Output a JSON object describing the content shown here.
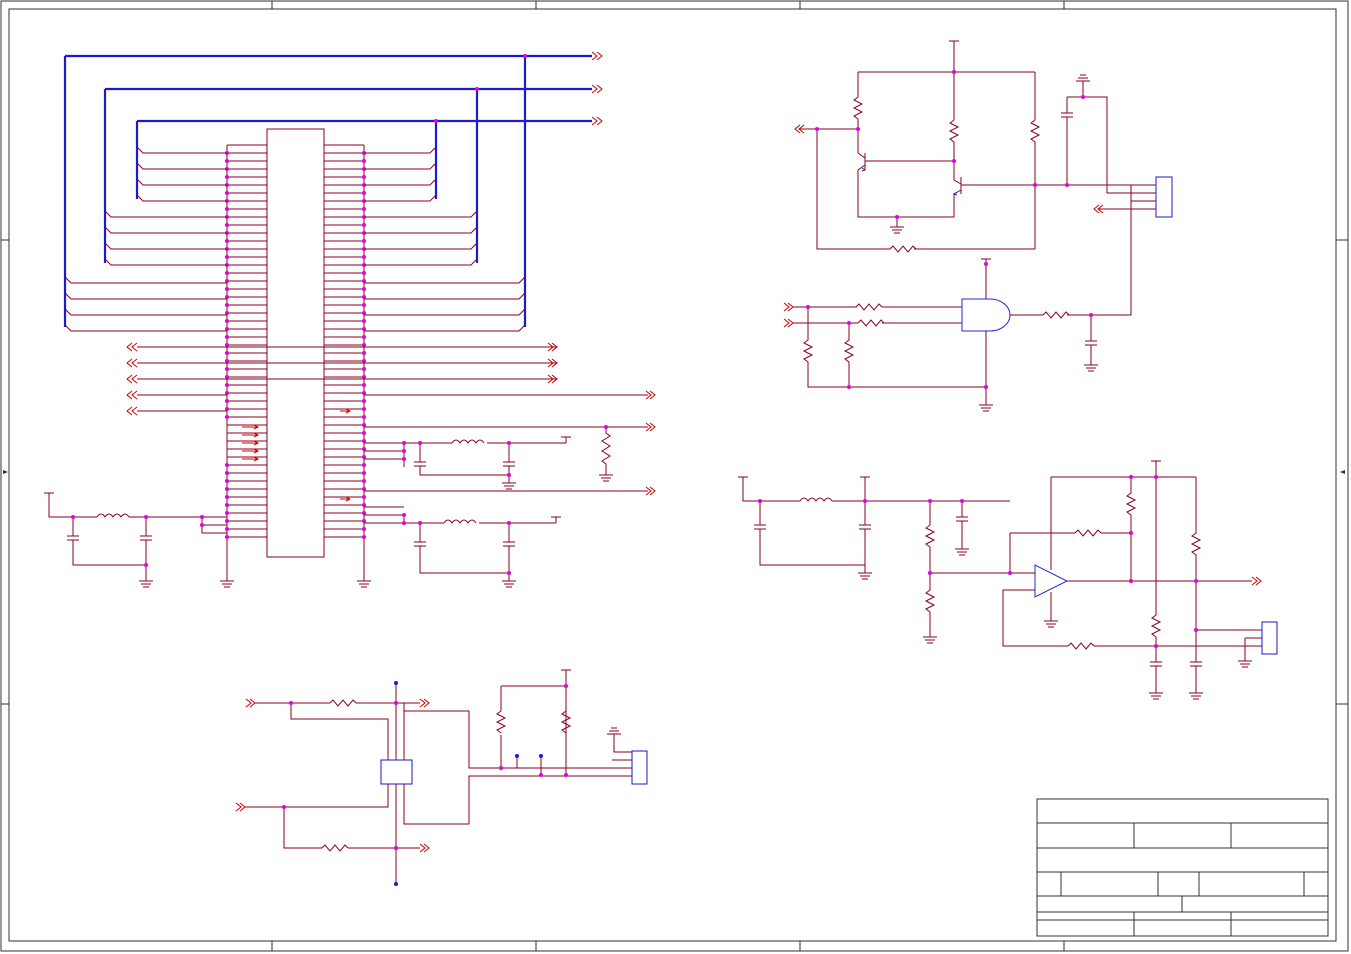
{
  "diagram": {
    "kind": "schematic",
    "colors": {
      "wire": "#8b0020",
      "bus": "#1a1ad0",
      "component": "#2a2acc",
      "port": "#cc0000",
      "junction": "#e000e0",
      "frame": "#333333",
      "background": "#ffffff"
    }
  }
}
